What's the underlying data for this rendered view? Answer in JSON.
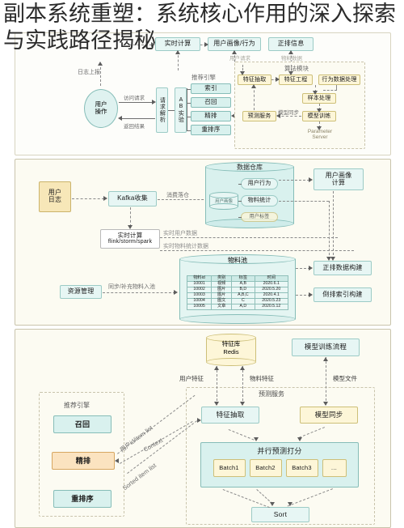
{
  "page": {
    "title": "副本系统重塑：系统核心作用的深入探索与实践路径揭秘"
  },
  "top_section": {
    "stream_boxes": [
      {
        "label": "实时计算"
      },
      {
        "label": "用户画像/行为"
      },
      {
        "label": "正排信息"
      }
    ],
    "log_report_label": "日志上报",
    "user_node": "用户\n操作",
    "request_label": "访问请求",
    "response_label": "返回结果",
    "request_parse": "请求解析",
    "ab_test": "AB实验",
    "engine_title": "推荐引擎",
    "engine_stages": [
      {
        "label": "索引"
      },
      {
        "label": "召回"
      },
      {
        "label": "精排"
      },
      {
        "label": "重排序"
      }
    ],
    "algo_title": "算法模块",
    "algo_nodes": [
      {
        "label": "特征抽取"
      },
      {
        "label": "特征工程"
      },
      {
        "label": "行为数据处理"
      },
      {
        "label": "样本处理"
      },
      {
        "label": "预测服务"
      },
      {
        "label": "模型训练"
      }
    ],
    "param_server": "Parameter\nServer",
    "model_sync_label": "模型同步",
    "user_upload_label": "用户请求",
    "material_label": "物料数据"
  },
  "mid_section": {
    "user_log": "用户\n日志",
    "kafka": "Kafka收集",
    "realtime_compute": "实时计算",
    "realtime_compute_sub": "flink/storm/spark",
    "consume_落仓": "消费落仓",
    "realtime_user_data": "实时用户数据",
    "realtime_material_stat": "实时物料统计数据",
    "warehouse_title": "数据仓库",
    "warehouse_cylinder": "用户画像",
    "warehouse_nodes": [
      {
        "label": "用户行为"
      },
      {
        "label": "物料统计"
      },
      {
        "label": "用户标签"
      }
    ],
    "profile_compute": "用户画像\n计算",
    "forward_build": "正排数据构建",
    "inverted_build": "倒排索引构建",
    "resource_mgmt": "资源管理",
    "sync_label": "同步/补充物料入池",
    "pool_title": "物料池",
    "pool_table": {
      "columns": [
        "物料id",
        "类别",
        "标签",
        "时间"
      ],
      "rows": [
        [
          "10001",
          "视频",
          "A,B",
          "2020.6.1"
        ],
        [
          "10002",
          "图片",
          "B,D",
          "2020.5.20"
        ],
        [
          "10003",
          "图片",
          "A,B,C",
          "2020.4.1"
        ],
        [
          "10004",
          "图文",
          "C",
          "2020.5.23"
        ],
        [
          "10005",
          "文章",
          "A,D",
          "2020.5.12"
        ]
      ]
    }
  },
  "bottom_section": {
    "feature_store": "特征库",
    "feature_store_sub": "Redis",
    "train_flow": "模型训练流程",
    "user_feature_label": "用户特征",
    "item_feature_label": "物料特征",
    "model_file_label": "模型文件",
    "predict_service_title": "预测服务",
    "feature_extract": "特征抽取",
    "model_sync": "模型同步",
    "parallel_score": "并行预测打分",
    "batches": [
      {
        "label": "Batch1"
      },
      {
        "label": "Batch2"
      },
      {
        "label": "Batch3"
      },
      {
        "label": "…"
      }
    ],
    "sort": "Sort",
    "engine_title": "推荐引擎",
    "engine_stages": [
      {
        "label": "召回"
      },
      {
        "label": "精排"
      },
      {
        "label": "重排序"
      }
    ],
    "flow_labels": {
      "request": "用户id/item list",
      "context": "Context",
      "result": "Sorted item list"
    }
  },
  "colors": {
    "cyan_fill": "#d9f1ee",
    "cyan_border": "#86bdb8",
    "yellow_fill": "#fdf6d8",
    "yellow_border": "#cdbf78",
    "orange_fill": "#fbe3c0",
    "panel_fill": "#fcfbf2",
    "panel_border": "#c9c4ac"
  }
}
